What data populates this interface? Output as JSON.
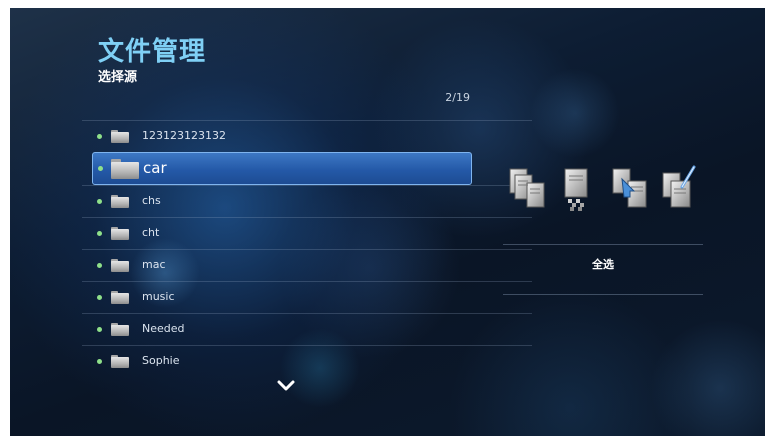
{
  "header": {
    "title": "文件管理",
    "subtitle": "选择源"
  },
  "pagination": {
    "counter": "2/19"
  },
  "folder_list": {
    "items": [
      {
        "label": "123123123132",
        "selected": false
      },
      {
        "label": "car",
        "selected": true
      },
      {
        "label": "chs",
        "selected": false
      },
      {
        "label": "cht",
        "selected": false
      },
      {
        "label": "mac",
        "selected": false
      },
      {
        "label": "music",
        "selected": false
      },
      {
        "label": "Needed",
        "selected": false
      },
      {
        "label": "Sophie",
        "selected": false
      }
    ],
    "more_indicator_icon": "chevron-down-icon"
  },
  "action_panel": {
    "icons": [
      "copy-icon",
      "delete-icon",
      "move-icon",
      "rename-icon"
    ],
    "select_all_label": "全选"
  },
  "colors": {
    "title": "#7fd0f5",
    "selection": "#2c63b0",
    "bullet": "#8fe08a"
  }
}
